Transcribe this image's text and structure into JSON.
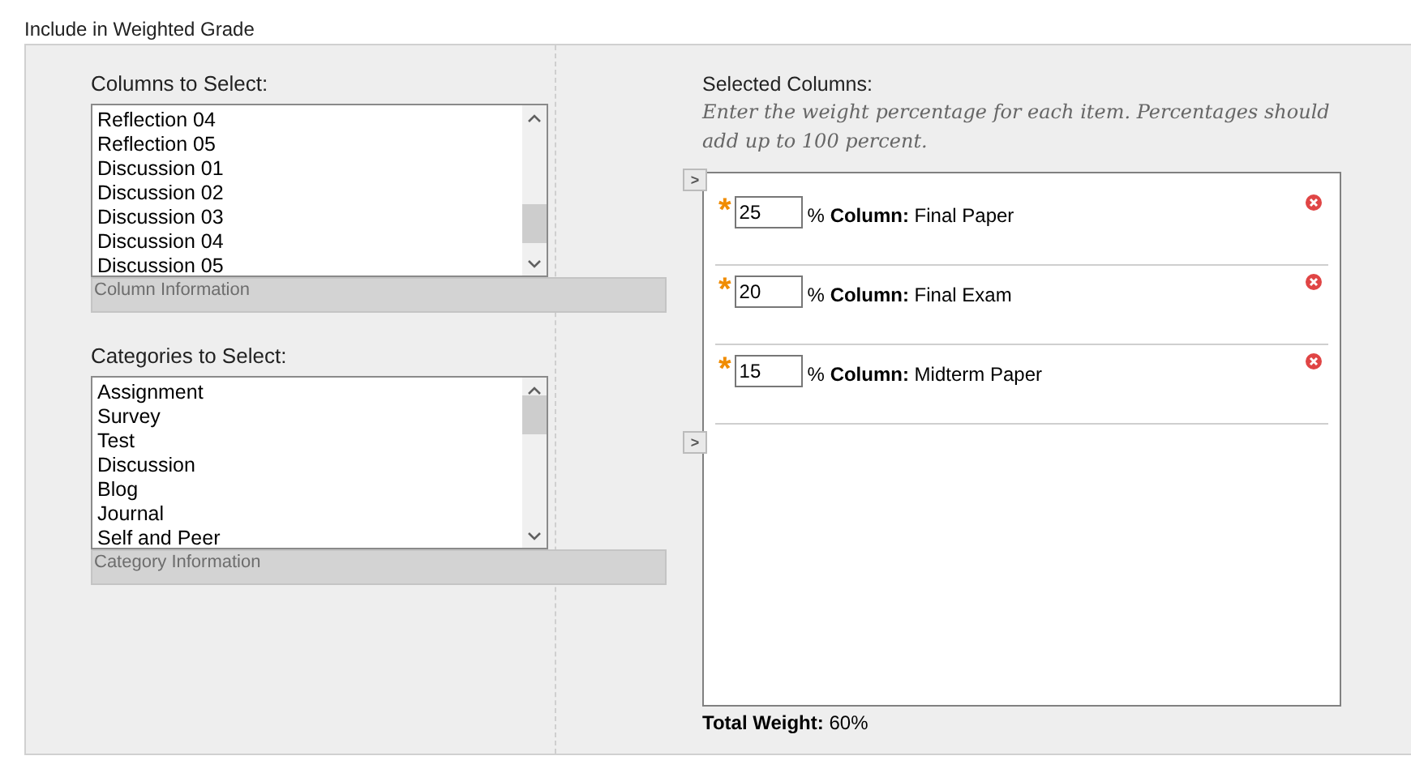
{
  "section_title": "Include in Weighted Grade",
  "columns_to_select": {
    "label": "Columns to Select:",
    "items": [
      "Reflection 04",
      "Reflection 05",
      "Discussion 01",
      "Discussion 02",
      "Discussion 03",
      "Discussion 04",
      "Discussion 05"
    ],
    "info": "Column Information",
    "move_button": ">"
  },
  "categories_to_select": {
    "label": "Categories to Select:",
    "items": [
      "Assignment",
      "Survey",
      "Test",
      "Discussion",
      "Blog",
      "Journal",
      "Self and Peer"
    ],
    "info": "Category Information",
    "move_button": ">"
  },
  "selected_columns": {
    "label": "Selected Columns:",
    "instructions": "Enter the weight percentage for each item. Percentages should add up to 100 percent.",
    "items": [
      {
        "required_mark": "*",
        "weight": "25",
        "prefix": "% **Column:** Final Paper"
      },
      {
        "required_mark": "*",
        "weight": "20",
        "prefix": "% **Column:** Final Exam"
      },
      {
        "required_mark": "*",
        "weight": "15",
        "prefix": "% **Column:** Midterm Paper"
      }
    ],
    "total": "**Total Weight:** 60%"
  }
}
